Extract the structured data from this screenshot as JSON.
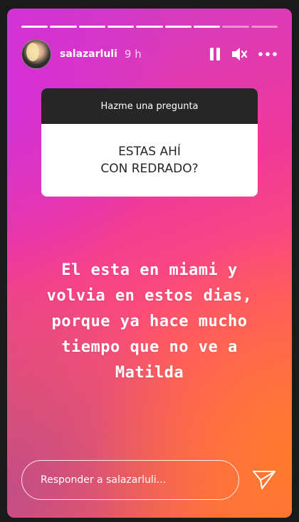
{
  "story": {
    "progress": {
      "segments": 9,
      "completed": 7
    },
    "author": {
      "username": "salazarluli",
      "time": "9 h"
    },
    "controls": {
      "pause_icon": "pause-icon",
      "mute_icon": "mute-icon",
      "more_icon": "more-icon"
    }
  },
  "question_box": {
    "title": "Hazme una pregunta",
    "question_lines": [
      "ESTAS AHÍ",
      "CON REDRADO?"
    ]
  },
  "answer_lines": [
    "El esta en miami y",
    "volvia en estos dias,",
    "porque ya hace mucho",
    "tiempo que no ve a",
    "Matilda"
  ],
  "reply": {
    "placeholder": "Responder a salazarluli..."
  },
  "colors": {
    "dark": "#262626",
    "text_on_gradient": "#ffffff"
  }
}
